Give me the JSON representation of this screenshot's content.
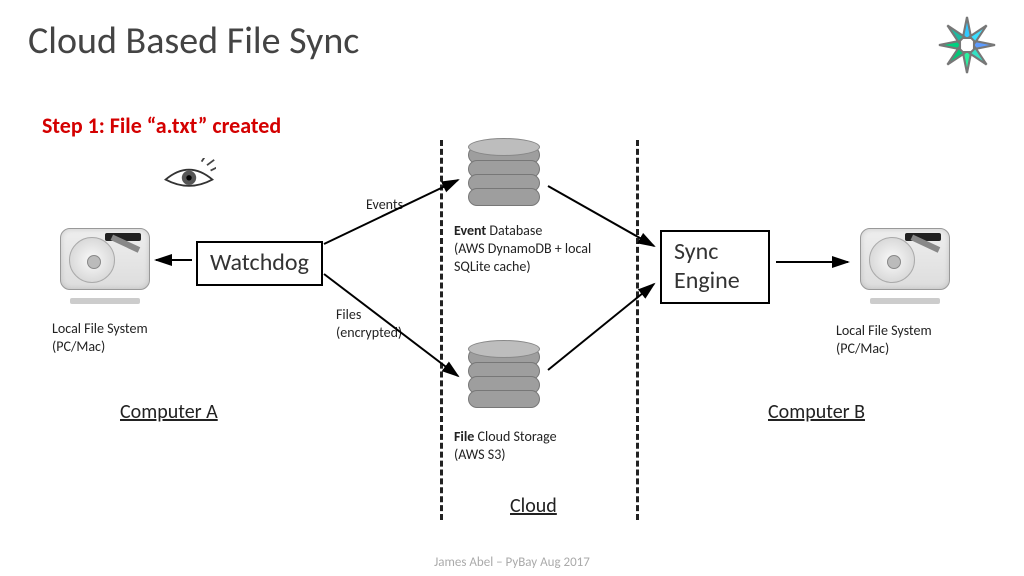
{
  "title": "Cloud Based File Sync",
  "step": "Step 1: File “a.txt” created",
  "footer": "James Abel – PyBay Aug 2017",
  "computerA": {
    "label": "Computer A",
    "filesystem_line1": "Local File System",
    "filesystem_line2": "(PC/Mac)",
    "watchdog_label": "Watchdog"
  },
  "computerB": {
    "label": "Computer B",
    "filesystem_line1": "Local File System",
    "filesystem_line2": "(PC/Mac)",
    "sync_engine_line1": "Sync",
    "sync_engine_line2": "Engine"
  },
  "cloud": {
    "label": "Cloud",
    "event_db_title": "Event",
    "event_db_rest": " Database",
    "event_db_line2": "(AWS DynamoDB + local",
    "event_db_line3": "SQLite cache)",
    "file_storage_title": "File",
    "file_storage_rest": " Cloud Storage",
    "file_storage_line2": "(AWS S3)"
  },
  "arrows": {
    "events": "Events",
    "files_line1": "Files",
    "files_line2": "(encrypted)"
  }
}
